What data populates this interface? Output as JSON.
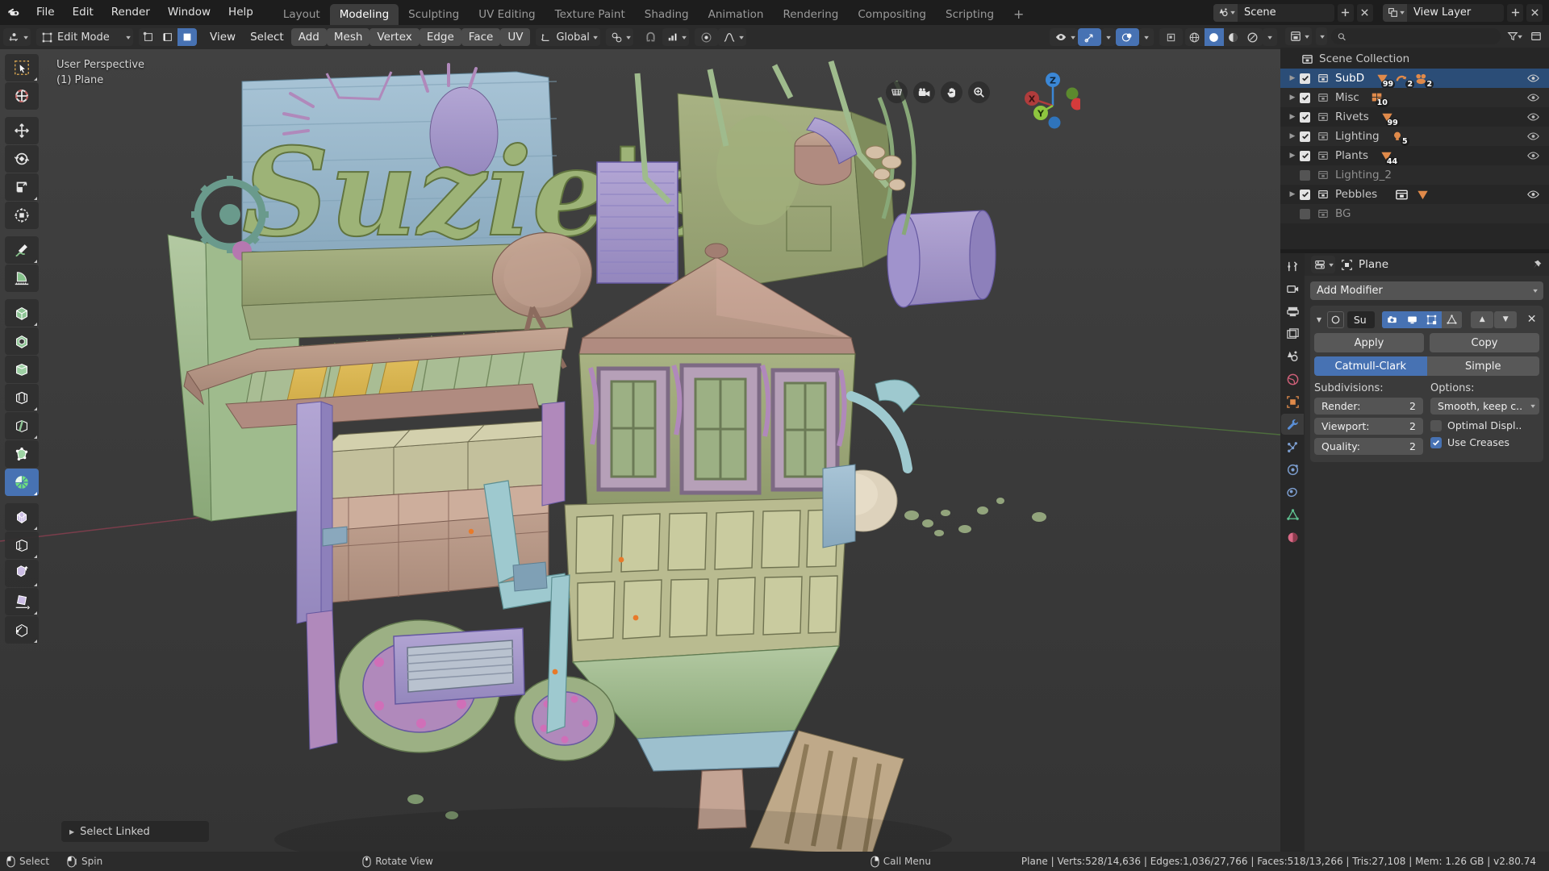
{
  "app": {
    "logo": "blender-logo",
    "menus": [
      "File",
      "Edit",
      "Render",
      "Window",
      "Help"
    ],
    "workspaces": [
      {
        "label": "Layout",
        "active": false
      },
      {
        "label": "Modeling",
        "active": true
      },
      {
        "label": "Sculpting",
        "active": false
      },
      {
        "label": "UV Editing",
        "active": false
      },
      {
        "label": "Texture Paint",
        "active": false
      },
      {
        "label": "Shading",
        "active": false
      },
      {
        "label": "Animation",
        "active": false
      },
      {
        "label": "Rendering",
        "active": false
      },
      {
        "label": "Compositing",
        "active": false
      },
      {
        "label": "Scripting",
        "active": false
      }
    ],
    "workspace_add": "+",
    "scene_name": "Scene",
    "view_layer_name": "View Layer"
  },
  "viewport_header": {
    "mode": "Edit Mode",
    "select_modes": [
      "vertex-select",
      "edge-select",
      "face-select"
    ],
    "select_mode_active": 2,
    "menus": [
      "View",
      "Select",
      "Add",
      "Mesh",
      "Vertex",
      "Edge",
      "Face",
      "UV"
    ],
    "highlighted_menus": [
      "Add",
      "Mesh",
      "Vertex",
      "Edge",
      "Face",
      "UV"
    ],
    "transform_orientation": "Global",
    "pivot": "pivot-point-icon",
    "snap": "magnet-icon",
    "snap_target": "snap-increment-icon",
    "proportional_edit": "proportional-editing-icon",
    "proportional_falloff": "smooth-falloff-icon",
    "overlay_icons": [
      "visibility-icon",
      "xray-toggle-icon",
      "overlays-toggle-icon"
    ],
    "shading_modes": [
      "wireframe-shading",
      "solid-shading",
      "material-preview-shading",
      "rendered-shading"
    ],
    "shading_active": 1
  },
  "viewport": {
    "perspective_label": "User Perspective",
    "object_label": "(1) Plane",
    "operator_panel": "Select Linked",
    "gizmo_axes": [
      "X",
      "Y",
      "Z"
    ],
    "nav_buttons": [
      "toggle-camera-perspective-icon",
      "camera-view-icon",
      "move-view-icon",
      "zoom-view-icon"
    ]
  },
  "toolbar": {
    "tools": [
      {
        "name": "tweak-select-box-tool",
        "selected": false,
        "group": 0
      },
      {
        "name": "cursor-tool",
        "selected": false,
        "group": 0
      },
      {
        "name": "move-tool",
        "selected": false,
        "group": 1
      },
      {
        "name": "rotate-tool",
        "selected": false,
        "group": 1
      },
      {
        "name": "scale-tool",
        "selected": false,
        "group": 1
      },
      {
        "name": "transform-tool",
        "selected": false,
        "group": 1
      },
      {
        "name": "annotate-tool",
        "selected": false,
        "group": 2
      },
      {
        "name": "measure-tool",
        "selected": false,
        "group": 2
      },
      {
        "name": "extrude-region-tool",
        "selected": false,
        "group": 3
      },
      {
        "name": "inset-faces-tool",
        "selected": false,
        "group": 3
      },
      {
        "name": "bevel-tool",
        "selected": false,
        "group": 3
      },
      {
        "name": "loop-cut-tool",
        "selected": false,
        "group": 3
      },
      {
        "name": "knife-tool",
        "selected": false,
        "group": 3
      },
      {
        "name": "poly-build-tool",
        "selected": false,
        "group": 3
      },
      {
        "name": "spin-tool",
        "selected": true,
        "group": 3
      },
      {
        "name": "smooth-tool",
        "selected": false,
        "group": 4
      },
      {
        "name": "edge-slide-tool",
        "selected": false,
        "group": 4
      },
      {
        "name": "shrink-fatten-tool",
        "selected": false,
        "group": 4
      },
      {
        "name": "shear-tool",
        "selected": false,
        "group": 4
      },
      {
        "name": "rip-region-tool",
        "selected": false,
        "group": 4
      }
    ]
  },
  "outliner": {
    "display_mode": "view-layer-icon",
    "search_placeholder": "",
    "filter_icon": "filter-icon",
    "new_collection_icon": "new-collection-icon",
    "root": "Scene Collection",
    "rows": [
      {
        "name": "SubD",
        "indent": 1,
        "expandable": true,
        "checked": true,
        "selected": true,
        "eye": true,
        "badges": [
          {
            "icon": "mesh-data-icon",
            "count": "99"
          },
          {
            "icon": "modifier-icon",
            "count": "2"
          },
          {
            "icon": "group-icon",
            "count": "2"
          }
        ]
      },
      {
        "name": "Misc",
        "indent": 1,
        "expandable": true,
        "checked": true,
        "selected": false,
        "eye": true,
        "badges": [
          {
            "icon": "mesh-grid-icon",
            "count": "10"
          }
        ]
      },
      {
        "name": "Rivets",
        "indent": 1,
        "expandable": true,
        "checked": true,
        "selected": false,
        "eye": true,
        "badges": [
          {
            "icon": "mesh-data-icon",
            "count": "99"
          }
        ]
      },
      {
        "name": "Lighting",
        "indent": 1,
        "expandable": true,
        "checked": true,
        "selected": false,
        "eye": true,
        "badges": [
          {
            "icon": "light-icon",
            "count": "5"
          }
        ]
      },
      {
        "name": "Plants",
        "indent": 1,
        "expandable": true,
        "checked": true,
        "selected": false,
        "eye": true,
        "badges": [
          {
            "icon": "mesh-data-icon",
            "count": "44"
          }
        ]
      },
      {
        "name": "Lighting_2",
        "indent": 1,
        "expandable": false,
        "checked": false,
        "selected": false,
        "eye": false,
        "badges": []
      },
      {
        "name": "Pebbles",
        "indent": 1,
        "expandable": true,
        "checked": true,
        "selected": false,
        "eye": true,
        "badges": [
          {
            "icon": "collection-icon",
            "count": ""
          },
          {
            "icon": "mesh-data-icon",
            "count": ""
          }
        ]
      },
      {
        "name": "BG",
        "indent": 1,
        "expandable": false,
        "checked": false,
        "selected": false,
        "eye": false,
        "badges": []
      }
    ]
  },
  "properties": {
    "editor_icon": "properties-editor-icon",
    "breadcrumb_icon": "object-icon",
    "breadcrumb": "Plane",
    "pin_icon": "pin-icon",
    "tabs": [
      {
        "name": "tool-tab",
        "active": false
      },
      {
        "name": "render-tab",
        "active": false
      },
      {
        "name": "output-tab",
        "active": false
      },
      {
        "name": "view-layer-tab",
        "active": false
      },
      {
        "name": "scene-tab",
        "active": false
      },
      {
        "name": "world-tab",
        "active": false
      },
      {
        "name": "object-tab",
        "active": false
      },
      {
        "name": "modifier-tab",
        "active": true
      },
      {
        "name": "particles-tab",
        "active": false
      },
      {
        "name": "physics-tab",
        "active": false
      },
      {
        "name": "constraints-tab",
        "active": false
      },
      {
        "name": "object-data-tab",
        "active": false
      },
      {
        "name": "material-tab",
        "active": false
      }
    ],
    "add_modifier": "Add Modifier",
    "modifier": {
      "icon": "subsurf-modifier-icon",
      "name": "Su",
      "display_toggles": [
        {
          "name": "render-visibility-toggle",
          "on": true
        },
        {
          "name": "viewport-visibility-toggle",
          "on": true
        },
        {
          "name": "edit-mode-display-toggle",
          "on": true
        },
        {
          "name": "on-cage-display-toggle",
          "on": false
        }
      ],
      "move_up": "▲",
      "move_down": "▼",
      "close": "✕",
      "apply_label": "Apply",
      "copy_label": "Copy",
      "algorithms": [
        {
          "label": "Catmull-Clark",
          "active": true
        },
        {
          "label": "Simple",
          "active": false
        }
      ],
      "subdivisions_label": "Subdivisions:",
      "options_label": "Options:",
      "fields": [
        {
          "label": "Render:",
          "value": "2"
        },
        {
          "label": "Viewport:",
          "value": "2"
        },
        {
          "label": "Quality:",
          "value": "2"
        }
      ],
      "uv_smooth": "Smooth, keep c..",
      "optimal_display": {
        "label": "Optimal Displ..",
        "checked": false
      },
      "use_creases": {
        "label": "Use Creases",
        "checked": true
      }
    }
  },
  "statusbar": {
    "keymap": [
      {
        "icon": "mouse-left-icon",
        "label": "Select"
      },
      {
        "icon": "mouse-left-drag-icon",
        "label": "Spin"
      },
      {
        "icon": "mouse-middle-icon",
        "label": "Rotate View"
      },
      {
        "icon": "mouse-right-icon",
        "label": "Call Menu"
      }
    ],
    "stats": "Plane | Verts:528/14,636 | Edges:1,036/27,766 | Faces:518/13,266 | Tris:27,108 | Mem: 1.26 GB | v2.80.74"
  },
  "colors": {
    "accent": "#4772b3",
    "header": "#2b2b2b",
    "panel": "#303030",
    "outliner_bg": "#262626",
    "selected_row": "#2b4d77",
    "orange": "#e08a4a"
  }
}
